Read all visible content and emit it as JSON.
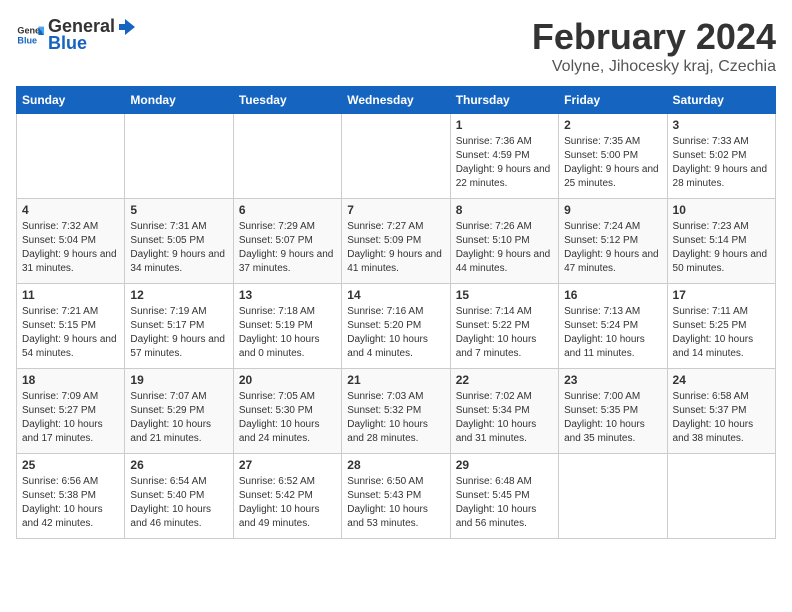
{
  "logo": {
    "text_general": "General",
    "text_blue": "Blue"
  },
  "title": "February 2024",
  "subtitle": "Volyne, Jihocesky kraj, Czechia",
  "days_of_week": [
    "Sunday",
    "Monday",
    "Tuesday",
    "Wednesday",
    "Thursday",
    "Friday",
    "Saturday"
  ],
  "weeks": [
    [
      {
        "day": "",
        "sunrise": "",
        "sunset": "",
        "daylight": ""
      },
      {
        "day": "",
        "sunrise": "",
        "sunset": "",
        "daylight": ""
      },
      {
        "day": "",
        "sunrise": "",
        "sunset": "",
        "daylight": ""
      },
      {
        "day": "",
        "sunrise": "",
        "sunset": "",
        "daylight": ""
      },
      {
        "day": "1",
        "sunrise": "Sunrise: 7:36 AM",
        "sunset": "Sunset: 4:59 PM",
        "daylight": "Daylight: 9 hours and 22 minutes."
      },
      {
        "day": "2",
        "sunrise": "Sunrise: 7:35 AM",
        "sunset": "Sunset: 5:00 PM",
        "daylight": "Daylight: 9 hours and 25 minutes."
      },
      {
        "day": "3",
        "sunrise": "Sunrise: 7:33 AM",
        "sunset": "Sunset: 5:02 PM",
        "daylight": "Daylight: 9 hours and 28 minutes."
      }
    ],
    [
      {
        "day": "4",
        "sunrise": "Sunrise: 7:32 AM",
        "sunset": "Sunset: 5:04 PM",
        "daylight": "Daylight: 9 hours and 31 minutes."
      },
      {
        "day": "5",
        "sunrise": "Sunrise: 7:31 AM",
        "sunset": "Sunset: 5:05 PM",
        "daylight": "Daylight: 9 hours and 34 minutes."
      },
      {
        "day": "6",
        "sunrise": "Sunrise: 7:29 AM",
        "sunset": "Sunset: 5:07 PM",
        "daylight": "Daylight: 9 hours and 37 minutes."
      },
      {
        "day": "7",
        "sunrise": "Sunrise: 7:27 AM",
        "sunset": "Sunset: 5:09 PM",
        "daylight": "Daylight: 9 hours and 41 minutes."
      },
      {
        "day": "8",
        "sunrise": "Sunrise: 7:26 AM",
        "sunset": "Sunset: 5:10 PM",
        "daylight": "Daylight: 9 hours and 44 minutes."
      },
      {
        "day": "9",
        "sunrise": "Sunrise: 7:24 AM",
        "sunset": "Sunset: 5:12 PM",
        "daylight": "Daylight: 9 hours and 47 minutes."
      },
      {
        "day": "10",
        "sunrise": "Sunrise: 7:23 AM",
        "sunset": "Sunset: 5:14 PM",
        "daylight": "Daylight: 9 hours and 50 minutes."
      }
    ],
    [
      {
        "day": "11",
        "sunrise": "Sunrise: 7:21 AM",
        "sunset": "Sunset: 5:15 PM",
        "daylight": "Daylight: 9 hours and 54 minutes."
      },
      {
        "day": "12",
        "sunrise": "Sunrise: 7:19 AM",
        "sunset": "Sunset: 5:17 PM",
        "daylight": "Daylight: 9 hours and 57 minutes."
      },
      {
        "day": "13",
        "sunrise": "Sunrise: 7:18 AM",
        "sunset": "Sunset: 5:19 PM",
        "daylight": "Daylight: 10 hours and 0 minutes."
      },
      {
        "day": "14",
        "sunrise": "Sunrise: 7:16 AM",
        "sunset": "Sunset: 5:20 PM",
        "daylight": "Daylight: 10 hours and 4 minutes."
      },
      {
        "day": "15",
        "sunrise": "Sunrise: 7:14 AM",
        "sunset": "Sunset: 5:22 PM",
        "daylight": "Daylight: 10 hours and 7 minutes."
      },
      {
        "day": "16",
        "sunrise": "Sunrise: 7:13 AM",
        "sunset": "Sunset: 5:24 PM",
        "daylight": "Daylight: 10 hours and 11 minutes."
      },
      {
        "day": "17",
        "sunrise": "Sunrise: 7:11 AM",
        "sunset": "Sunset: 5:25 PM",
        "daylight": "Daylight: 10 hours and 14 minutes."
      }
    ],
    [
      {
        "day": "18",
        "sunrise": "Sunrise: 7:09 AM",
        "sunset": "Sunset: 5:27 PM",
        "daylight": "Daylight: 10 hours and 17 minutes."
      },
      {
        "day": "19",
        "sunrise": "Sunrise: 7:07 AM",
        "sunset": "Sunset: 5:29 PM",
        "daylight": "Daylight: 10 hours and 21 minutes."
      },
      {
        "day": "20",
        "sunrise": "Sunrise: 7:05 AM",
        "sunset": "Sunset: 5:30 PM",
        "daylight": "Daylight: 10 hours and 24 minutes."
      },
      {
        "day": "21",
        "sunrise": "Sunrise: 7:03 AM",
        "sunset": "Sunset: 5:32 PM",
        "daylight": "Daylight: 10 hours and 28 minutes."
      },
      {
        "day": "22",
        "sunrise": "Sunrise: 7:02 AM",
        "sunset": "Sunset: 5:34 PM",
        "daylight": "Daylight: 10 hours and 31 minutes."
      },
      {
        "day": "23",
        "sunrise": "Sunrise: 7:00 AM",
        "sunset": "Sunset: 5:35 PM",
        "daylight": "Daylight: 10 hours and 35 minutes."
      },
      {
        "day": "24",
        "sunrise": "Sunrise: 6:58 AM",
        "sunset": "Sunset: 5:37 PM",
        "daylight": "Daylight: 10 hours and 38 minutes."
      }
    ],
    [
      {
        "day": "25",
        "sunrise": "Sunrise: 6:56 AM",
        "sunset": "Sunset: 5:38 PM",
        "daylight": "Daylight: 10 hours and 42 minutes."
      },
      {
        "day": "26",
        "sunrise": "Sunrise: 6:54 AM",
        "sunset": "Sunset: 5:40 PM",
        "daylight": "Daylight: 10 hours and 46 minutes."
      },
      {
        "day": "27",
        "sunrise": "Sunrise: 6:52 AM",
        "sunset": "Sunset: 5:42 PM",
        "daylight": "Daylight: 10 hours and 49 minutes."
      },
      {
        "day": "28",
        "sunrise": "Sunrise: 6:50 AM",
        "sunset": "Sunset: 5:43 PM",
        "daylight": "Daylight: 10 hours and 53 minutes."
      },
      {
        "day": "29",
        "sunrise": "Sunrise: 6:48 AM",
        "sunset": "Sunset: 5:45 PM",
        "daylight": "Daylight: 10 hours and 56 minutes."
      },
      {
        "day": "",
        "sunrise": "",
        "sunset": "",
        "daylight": ""
      },
      {
        "day": "",
        "sunrise": "",
        "sunset": "",
        "daylight": ""
      }
    ]
  ]
}
